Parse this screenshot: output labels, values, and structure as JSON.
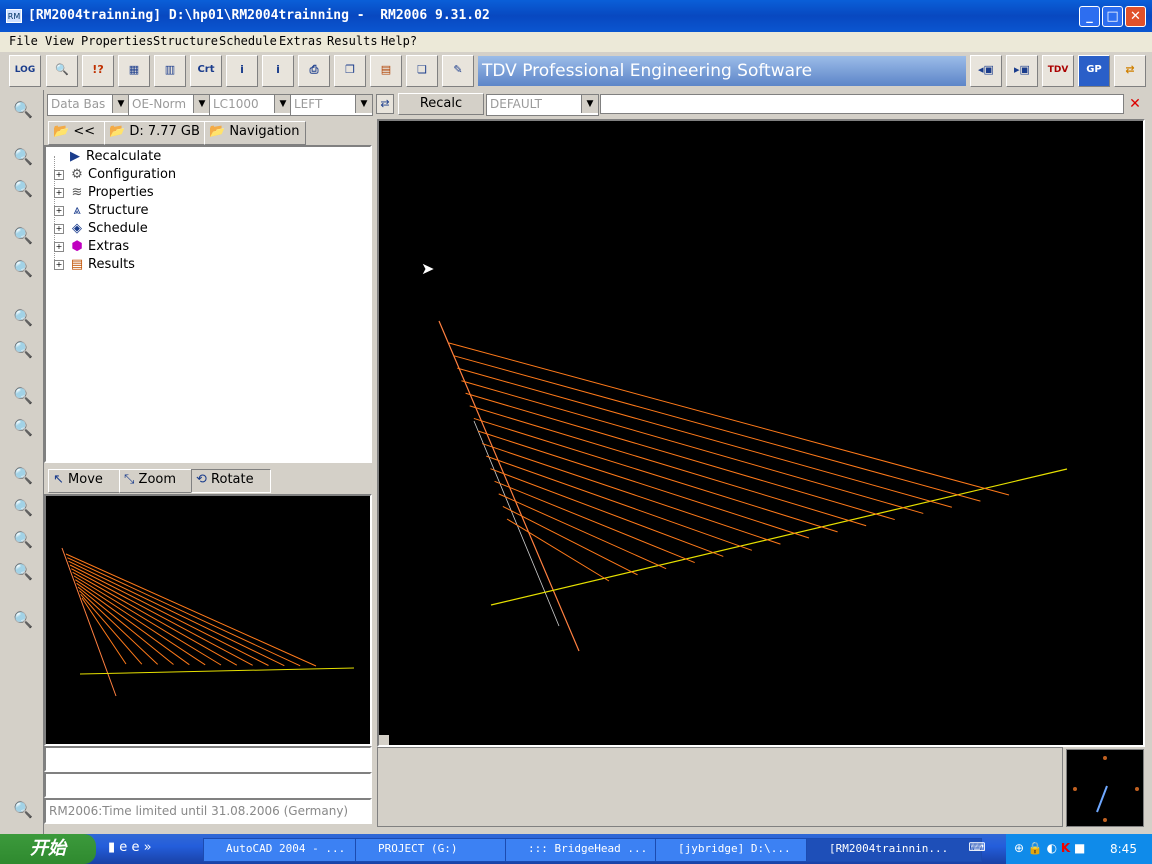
{
  "window": {
    "title": "[RM2004trainning] D:\\hp01\\RM2004trainning -  RM2006 9.31.02",
    "app_icon": "RM",
    "controls": {
      "minimize": "_",
      "maximize": "□",
      "close": "✕"
    }
  },
  "menu": [
    "File",
    "View",
    "Properties",
    "Structure",
    "Schedule",
    "Extras",
    "Results",
    "Help?"
  ],
  "toolbar": {
    "buttons": [
      {
        "name": "log",
        "glyph": "LOG"
      },
      {
        "name": "search-doc",
        "glyph": "🔍"
      },
      {
        "name": "help",
        "glyph": "!?"
      },
      {
        "name": "calculator",
        "glyph": "▦"
      },
      {
        "name": "chart",
        "glyph": "▥"
      },
      {
        "name": "crt",
        "glyph": "Crt"
      },
      {
        "name": "user-info",
        "glyph": "i"
      },
      {
        "name": "info",
        "glyph": "i"
      },
      {
        "name": "print",
        "glyph": "⎙"
      },
      {
        "name": "book",
        "glyph": "❐"
      },
      {
        "name": "books",
        "glyph": "▤"
      },
      {
        "name": "copy",
        "glyph": "❏"
      },
      {
        "name": "edit",
        "glyph": "✎"
      }
    ],
    "banner": "TDV Professional Engineering Software",
    "right_buttons": [
      {
        "name": "save-left",
        "glyph": "◂▣"
      },
      {
        "name": "save-right",
        "glyph": "▸▣"
      },
      {
        "name": "tdv-www",
        "glyph": "TDV"
      },
      {
        "name": "gp",
        "glyph": "GP"
      },
      {
        "name": "swap",
        "glyph": "⇄"
      }
    ]
  },
  "selectors": {
    "database": "Data Bas",
    "norm": "OE-Norm",
    "loadcase": "LC1000",
    "side": "LEFT"
  },
  "path_bar": {
    "back": "<<",
    "drive": "D: 7.77 GB",
    "navigation": "Navigation"
  },
  "tree": [
    {
      "label": "Recalculate",
      "icon": "play-icon",
      "glyph": "▶",
      "expand": ""
    },
    {
      "label": "Configuration",
      "icon": "config-icon",
      "glyph": "⚙",
      "expand": "+"
    },
    {
      "label": "Properties",
      "icon": "layers-icon",
      "glyph": "≋",
      "expand": "+"
    },
    {
      "label": "Structure",
      "icon": "structure-icon",
      "glyph": "⩓",
      "expand": "+"
    },
    {
      "label": "Schedule",
      "icon": "schedule-icon",
      "glyph": "◈",
      "expand": "+"
    },
    {
      "label": "Extras",
      "icon": "extras-icon",
      "glyph": "⬢",
      "expand": "+"
    },
    {
      "label": "Results",
      "icon": "results-icon",
      "glyph": "▤",
      "expand": "+"
    }
  ],
  "view_tabs": {
    "move": "Move",
    "zoom": "Zoom",
    "rotate": "Rotate"
  },
  "status": {
    "line1": "",
    "line2": "",
    "line3": "RM2006:Time limited until 31.08.2006 (Germany)"
  },
  "main_toolbar": {
    "recalc": "Recalc",
    "combo": "DEFAULT",
    "input": ""
  },
  "taskbar": {
    "start": "开始",
    "tasks": [
      {
        "label": "AutoCAD 2004 - ...",
        "icon": "autocad-icon"
      },
      {
        "label": "PROJECT (G:)",
        "icon": "folder-icon"
      },
      {
        "label": "::: BridgeHead ...",
        "icon": "m-icon"
      },
      {
        "label": "[jybridge]  D:\\...",
        "icon": "gp-icon"
      },
      {
        "label": "[RM2004trainnin...",
        "icon": "rm-icon"
      }
    ],
    "clock": "8:45"
  },
  "colors": {
    "viewport_bg": "#000000",
    "cable": "#ff7a1a",
    "deck": "#e6e000",
    "pylon": "#ff8040"
  }
}
